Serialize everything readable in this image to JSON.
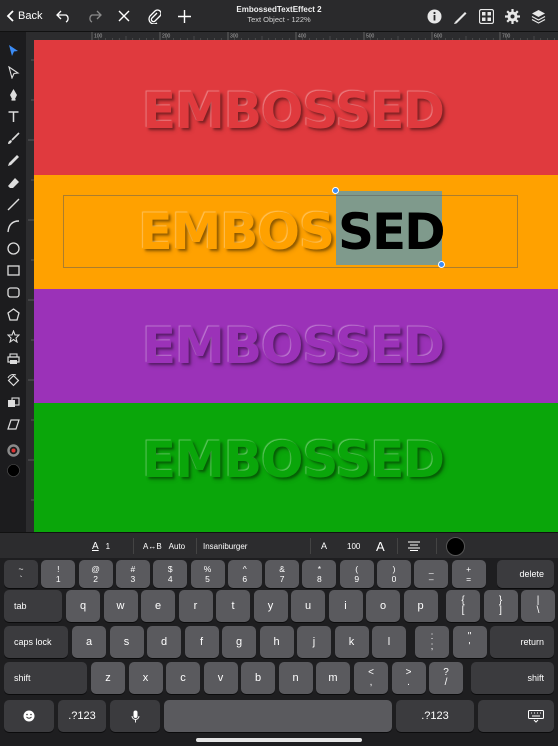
{
  "topbar": {
    "back_label": "Back",
    "document_title": "EmbossedTextEffect 2",
    "document_subtitle": "Text Object - 122%",
    "left_icons": [
      "undo-icon",
      "redo-icon",
      "close-icon",
      "paperclip-icon",
      "plus-icon"
    ],
    "right_icons": [
      "info-icon",
      "pencil-ruler-icon",
      "grid-icon",
      "gear-icon",
      "layers-icon"
    ]
  },
  "ruler": {
    "ticks": [
      "100",
      "200",
      "300",
      "400",
      "500",
      "600",
      "700"
    ]
  },
  "toolbar": {
    "tools": [
      "select-arrow-icon",
      "direct-select-icon",
      "pen-icon",
      "text-icon",
      "brush-icon",
      "pencil-icon",
      "eraser-icon",
      "line-icon",
      "curve-icon",
      "ellipse-icon",
      "rectangle-icon",
      "rounded-rectangle-icon",
      "polygon-icon",
      "star-icon",
      "print-icon",
      "transform-icon",
      "mask-icon",
      "skew-icon"
    ],
    "stroke_color": "#888888",
    "fill_color": "#000000"
  },
  "canvas": {
    "bands": [
      {
        "color": "#e03a3e",
        "text": "EMBOSSED",
        "text_color": "#e03a3e"
      },
      {
        "color": "#ffa100",
        "text": "EMBOS",
        "text_color": "#ffa100",
        "selected_text": "SED"
      },
      {
        "color": "#9b32b8",
        "text": "EMBOSSED",
        "text_color": "#9b32b8"
      },
      {
        "color": "#0aa60a",
        "text": "EMBOSSED",
        "text_color": "#0aa60a"
      }
    ]
  },
  "formatbar": {
    "baseline_value": "1",
    "kerning_label": "A↔B",
    "kerning_value": "Auto",
    "font_name": "Insaniburger",
    "size_small_label": "A",
    "font_size": "100",
    "size_large_label": "A",
    "text_color": "#000000"
  },
  "keyboard": {
    "row1": [
      {
        "top": "~",
        "bottom": "`"
      },
      {
        "top": "!",
        "bottom": "1"
      },
      {
        "top": "@",
        "bottom": "2"
      },
      {
        "top": "#",
        "bottom": "3"
      },
      {
        "top": "$",
        "bottom": "4"
      },
      {
        "top": "%",
        "bottom": "5"
      },
      {
        "top": "^",
        "bottom": "6"
      },
      {
        "top": "&",
        "bottom": "7"
      },
      {
        "top": "*",
        "bottom": "8"
      },
      {
        "top": "(",
        "bottom": "9"
      },
      {
        "top": ")",
        "bottom": "0"
      },
      {
        "top": "_",
        "bottom": "–"
      },
      {
        "top": "+",
        "bottom": "="
      }
    ],
    "delete_label": "delete",
    "tab_label": "tab",
    "row2": [
      "q",
      "w",
      "e",
      "r",
      "t",
      "y",
      "u",
      "i",
      "o",
      "p"
    ],
    "row2_sym": [
      {
        "top": "{",
        "bottom": "["
      },
      {
        "top": "}",
        "bottom": "]"
      },
      {
        "top": "|",
        "bottom": "\\"
      }
    ],
    "caps_label": "caps lock",
    "row3": [
      "a",
      "s",
      "d",
      "f",
      "g",
      "h",
      "j",
      "k",
      "l"
    ],
    "row3_sym": [
      {
        "top": ":",
        "bottom": ";"
      },
      {
        "top": "\"",
        "bottom": "'"
      }
    ],
    "return_label": "return",
    "shift_label": "shift",
    "row4": [
      "z",
      "x",
      "c",
      "v",
      "b",
      "n",
      "m"
    ],
    "row4_sym": [
      {
        "top": "<",
        "bottom": ","
      },
      {
        "top": ">",
        "bottom": "."
      },
      {
        "top": "?",
        "bottom": "/"
      }
    ],
    "emoji_icon": "emoji-icon",
    "num_label": ".?123",
    "mic_icon": "microphone-icon",
    "hide_icon": "keyboard-hide-icon"
  }
}
